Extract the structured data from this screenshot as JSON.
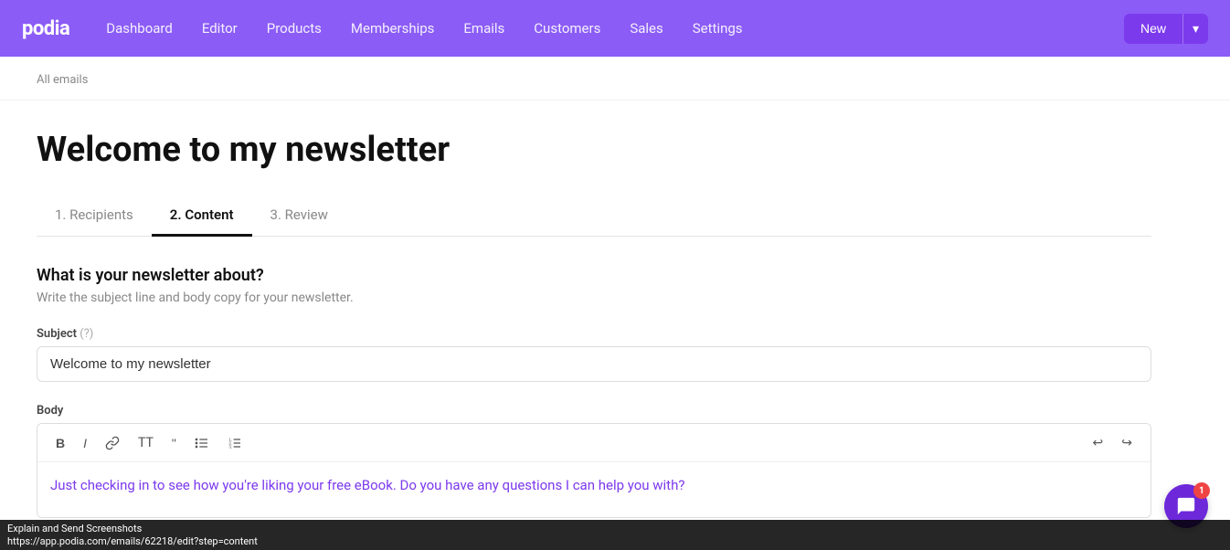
{
  "brand": {
    "logo": "podia"
  },
  "navbar": {
    "links": [
      {
        "id": "dashboard",
        "label": "Dashboard"
      },
      {
        "id": "editor",
        "label": "Editor"
      },
      {
        "id": "products",
        "label": "Products"
      },
      {
        "id": "memberships",
        "label": "Memberships"
      },
      {
        "id": "emails",
        "label": "Emails"
      },
      {
        "id": "customers",
        "label": "Customers"
      },
      {
        "id": "sales",
        "label": "Sales"
      },
      {
        "id": "settings",
        "label": "Settings"
      }
    ],
    "new_button": "New",
    "new_button_dropdown_icon": "▾"
  },
  "breadcrumb": {
    "text": "All emails"
  },
  "page": {
    "title": "Welcome to my newsletter"
  },
  "tabs": [
    {
      "id": "recipients",
      "label": "1. Recipients",
      "active": false
    },
    {
      "id": "content",
      "label": "2. Content",
      "active": true
    },
    {
      "id": "review",
      "label": "3. Review",
      "active": false
    }
  ],
  "section": {
    "title": "What is your newsletter about?",
    "description": "Write the subject line and body copy for your newsletter."
  },
  "form": {
    "subject_label": "Subject",
    "subject_hint": "(?)",
    "subject_value": "Welcome to my newsletter",
    "body_label": "Body"
  },
  "editor": {
    "toolbar": {
      "bold": "B",
      "italic": "I",
      "link": "🔗",
      "tt": "TT",
      "quote": "\"",
      "ul": "≡",
      "ol": "≣",
      "undo": "↩",
      "redo": "↪"
    },
    "body_text": "Just checking in to see how you're liking your free eBook. Do you have any questions I can help you with?"
  },
  "chat": {
    "badge": "1"
  },
  "status_bar": {
    "line1": "Explain and Send Screenshots",
    "line2": "https://app.podia.com/emails/62218/edit?step=content"
  }
}
